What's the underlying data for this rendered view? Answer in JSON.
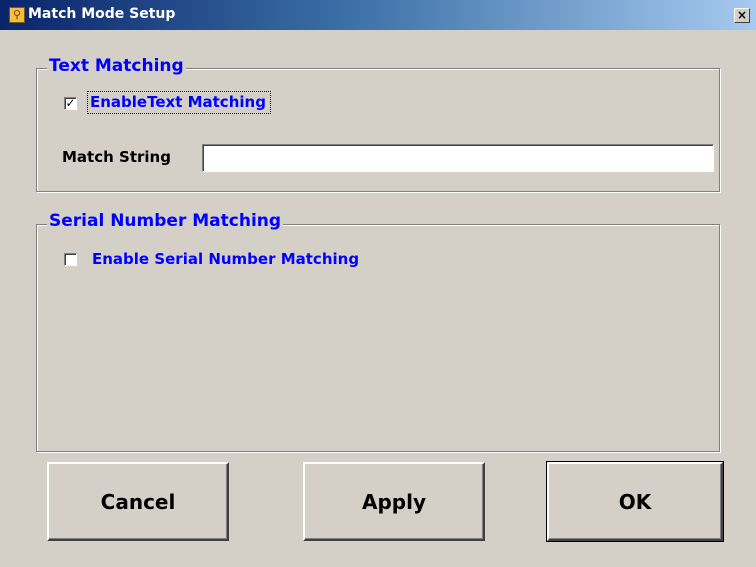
{
  "window": {
    "title": "Match Mode Setup",
    "close_glyph": "×",
    "icon": "running-man-icon"
  },
  "text_matching": {
    "group_label": "Text Matching",
    "enable_label": "EnableText Matching",
    "enable_checked": true,
    "check_glyph": "✓",
    "match_string_label": "Match String",
    "match_string_value": ""
  },
  "serial_matching": {
    "group_label": "Serial Number Matching",
    "enable_label": "Enable Serial Number Matching",
    "enable_checked": false
  },
  "buttons": {
    "cancel": "Cancel",
    "apply": "Apply",
    "ok": "OK"
  },
  "colors": {
    "accent_text": "#0000ff",
    "face": "#d4d0c8",
    "title_start": "#0a246a",
    "title_end": "#a6caf0"
  }
}
